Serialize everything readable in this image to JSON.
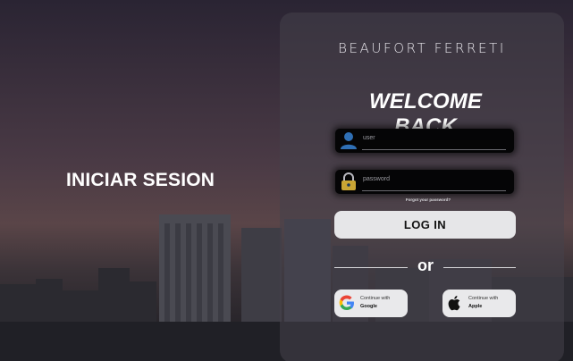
{
  "left": {
    "heading": "INICIAR SESION"
  },
  "panel": {
    "brand": "BEAUFORT FERRETI",
    "welcome": "WELCOME BACK",
    "user_placeholder": "user",
    "password_placeholder": "password",
    "forgot": "Forgot your password?",
    "login_label": "LOG IN",
    "or_label": "or",
    "google": {
      "line1": "Continue with",
      "line2": "Google"
    },
    "apple": {
      "line1": "Continue with",
      "line2": "Apple"
    }
  },
  "icons": {
    "user": "user-icon",
    "lock": "lock-icon",
    "google": "google-icon",
    "apple": "apple-icon"
  },
  "colors": {
    "icon_blue": "#2f6fb5",
    "lock_gold": "#c9a534",
    "button_bg": "#e6e6e8"
  }
}
